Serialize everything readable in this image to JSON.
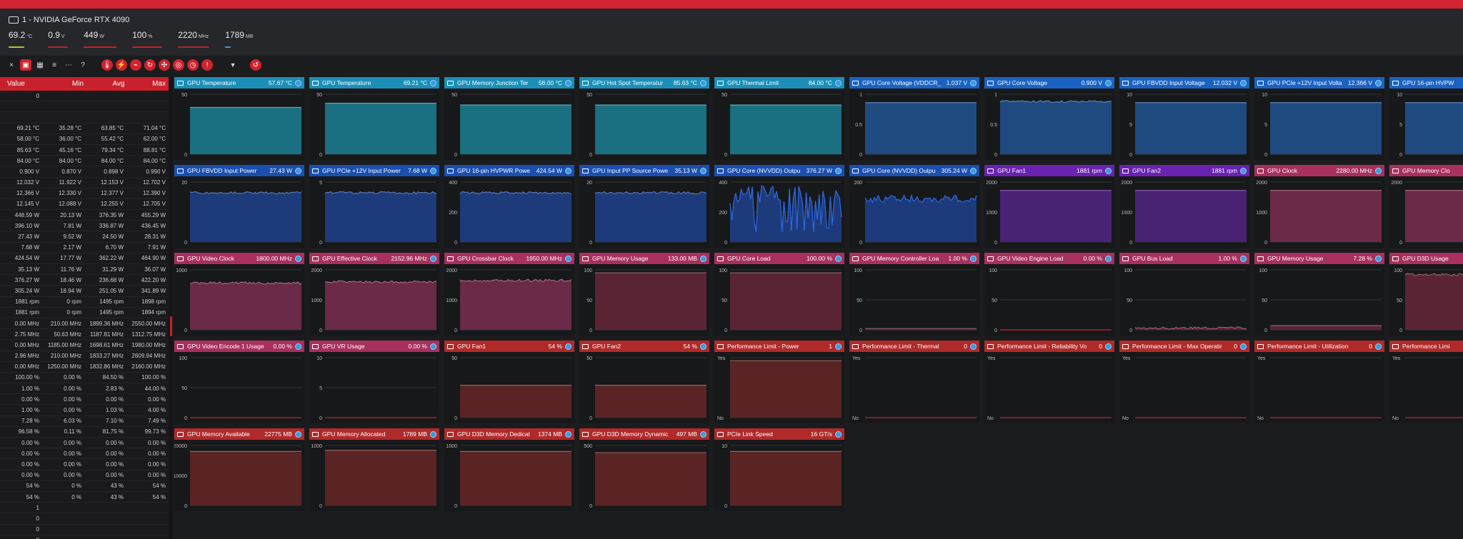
{
  "header": {
    "gpu_title": "1 - NVIDIA GeForce RTX 4090",
    "stats": [
      {
        "value": "69.2",
        "unit": "°C",
        "color": "#a0d22a",
        "level": 0.69
      },
      {
        "value": "0.9",
        "unit": "V",
        "color": "#c8202c",
        "level": 0.0
      },
      {
        "value": "449",
        "unit": "W",
        "color": "#c8202c",
        "level": 1.0
      },
      {
        "value": "100",
        "unit": "%",
        "color": "#c8202c",
        "level": 1.0
      },
      {
        "value": "2220",
        "unit": "MHz",
        "color": "#c8202c",
        "level": 0.0
      },
      {
        "value": "1789",
        "unit": "MB",
        "color": "#3a9be0",
        "level": 0.07
      }
    ]
  },
  "toolbar": {
    "icons": [
      "close-icon",
      "graph-icon",
      "layout-icon",
      "list-icon",
      "more-icon",
      "help-icon",
      "temperature-icon",
      "power-icon",
      "voltage-icon",
      "speed-icon",
      "fan-icon",
      "gauge-icon",
      "clock-icon",
      "alert-icon",
      "filter-icon",
      "reset-icon"
    ]
  },
  "table": {
    "headers": [
      "Value",
      "Min",
      "Avg",
      "Max"
    ],
    "rows": [
      [
        "0",
        "",
        "",
        ""
      ],
      [
        "",
        "",
        "",
        ""
      ],
      [
        "",
        "",
        "",
        ""
      ],
      [
        "69.21 °C",
        "35.28 °C",
        "63.85 °C",
        "71.04 °C"
      ],
      [
        "58.00 °C",
        "36.00 °C",
        "55.42 °C",
        "62.00 °C"
      ],
      [
        "85.63 °C",
        "45.16 °C",
        "79.34 °C",
        "88.81 °C"
      ],
      [
        "84.00 °C",
        "84.00 °C",
        "84.00 °C",
        "84.00 °C"
      ],
      [
        "0.900 V",
        "0.870 V",
        "0.898 V",
        "0.990 V"
      ],
      [
        "12.032 V",
        "11.922 V",
        "12.153 V",
        "12.702 V"
      ],
      [
        "12.366 V",
        "12.330 V",
        "12.377 V",
        "12.390 V"
      ],
      [
        "12.145 V",
        "12.088 V",
        "12.255 V",
        "12.705 V"
      ],
      [
        "448.59 W",
        "20.13 W",
        "376.35 W",
        "455.29 W"
      ],
      [
        "396.10 W",
        "7.81 W",
        "336.87 W",
        "436.45 W"
      ],
      [
        "27.43 W",
        "9.52 W",
        "24.50 W",
        "28.31 W"
      ],
      [
        "7.68 W",
        "2.17 W",
        "6.70 W",
        "7.91 W"
      ],
      [
        "424.54 W",
        "17.77 W",
        "362.22 W",
        "464.90 W"
      ],
      [
        "35.13 W",
        "11.76 W",
        "31.29 W",
        "36.07 W"
      ],
      [
        "376.27 W",
        "18.46 W",
        "236.68 W",
        "422.20 W"
      ],
      [
        "305.24 W",
        "18.94 W",
        "251.05 W",
        "341.89 W"
      ],
      [
        "1881 rpm",
        "0 rpm",
        "1495 rpm",
        "1898 rpm"
      ],
      [
        "1881 rpm",
        "0 rpm",
        "1495 rpm",
        "1894 rpm"
      ],
      [
        "0.00 MHz",
        "210.00 MHz",
        "1899.36 MHz",
        "2550.00 MHz"
      ],
      [
        "2.75 MHz",
        "50.63 MHz",
        "1187.81 MHz",
        "1312.75 MHz"
      ],
      [
        "0.00 MHz",
        "1185.00 MHz",
        "1698.61 MHz",
        "1980.00 MHz"
      ],
      [
        "2.96 MHz",
        "210.00 MHz",
        "1833.27 MHz",
        "2609.94 MHz"
      ],
      [
        "0.00 MHz",
        "1250.00 MHz",
        "1832.86 MHz",
        "2160.00 MHz"
      ],
      [
        "100.00 %",
        "0.00 %",
        "84.50 %",
        "100.00 %"
      ],
      [
        "1.00 %",
        "0.00 %",
        "2.83 %",
        "44.00 %"
      ],
      [
        "0.00 %",
        "0.00 %",
        "0.00 %",
        "0.00 %"
      ],
      [
        "1.00 %",
        "0.00 %",
        "1.03 %",
        "4.00 %"
      ],
      [
        "7.28 %",
        "6.03 %",
        "7.10 %",
        "7.49 %"
      ],
      [
        "96.58 %",
        "0.11 %",
        "81.75 %",
        "99.73 %"
      ],
      [
        "0.00 %",
        "0.00 %",
        "0.00 %",
        "0.00 %"
      ],
      [
        "0.00 %",
        "0.00 %",
        "0.00 %",
        "0.00 %"
      ],
      [
        "0.00 %",
        "0.00 %",
        "0.00 %",
        "0.00 %"
      ],
      [
        "0.00 %",
        "0.00 %",
        "0.00 %",
        "0.00 %"
      ],
      [
        "54 %",
        "0 %",
        "43 %",
        "54 %"
      ],
      [
        "54 %",
        "0 %",
        "43 %",
        "54 %"
      ],
      [
        "1",
        "",
        "",
        ""
      ],
      [
        "0",
        "",
        "",
        ""
      ],
      [
        "0",
        "",
        "",
        ""
      ],
      [
        "0",
        "",
        "",
        ""
      ]
    ]
  },
  "panels": [
    {
      "name": "GPU Temperature",
      "value": "57.67 °C",
      "color": "#1b8fb8",
      "chart": "#1a6f80",
      "ymax": "",
      "yticks": [
        "50",
        "0"
      ],
      "level": 0.78,
      "kind": "flat"
    },
    {
      "name": "GPU Temperature",
      "value": "69.21 °C",
      "color": "#1b8fb8",
      "chart": "#1a6f80",
      "yticks": [
        "50",
        "0"
      ],
      "level": 0.85,
      "kind": "flat"
    },
    {
      "name": "GPU Memory Junction Ter",
      "value": "58.00 °C",
      "color": "#1b8fb8",
      "chart": "#1a6f80",
      "yticks": [
        "50",
        "0"
      ],
      "level": 0.82,
      "kind": "flat"
    },
    {
      "name": "GPU Hot Spot Temperatur",
      "value": "85.63 °C",
      "color": "#1b8fb8",
      "chart": "#1a6f80",
      "yticks": [
        "50",
        "0"
      ],
      "level": 0.82,
      "kind": "flat"
    },
    {
      "name": "GPU Thermal Limit",
      "value": "84.00 °C",
      "color": "#1b8fb8",
      "chart": "#1a6f80",
      "yticks": [
        "50",
        "0"
      ],
      "level": 0.82,
      "kind": "flat"
    },
    {
      "name": "GPU Core Voltage (VDDCR_",
      "value": "1.037 V",
      "color": "#1a63c2",
      "chart": "#1f4a80",
      "yticks": [
        "1",
        "0.5",
        "0"
      ],
      "level": 0.86,
      "kind": "flat"
    },
    {
      "name": "GPU Core Voltage",
      "value": "0.900 V",
      "color": "#1a63c2",
      "chart": "#1f4a80",
      "yticks": [
        "1",
        "0.5",
        "0"
      ],
      "level": 0.88,
      "kind": "noisy"
    },
    {
      "name": "GPU FBVDD Input Voltage",
      "value": "12.032 V",
      "color": "#1a63c2",
      "chart": "#1f4a80",
      "yticks": [
        "10",
        "5",
        "0"
      ],
      "level": 0.86,
      "kind": "flat"
    },
    {
      "name": "GPU PCIe +12V Input Volta",
      "value": "12.366 V",
      "color": "#1a63c2",
      "chart": "#1f4a80",
      "yticks": [
        "10",
        "5",
        "0"
      ],
      "level": 0.86,
      "kind": "flat"
    },
    {
      "name": "GPU 16-pin HVPW",
      "value": "",
      "color": "#1a63c2",
      "chart": "#1f4a80",
      "yticks": [
        "10",
        "5",
        "0"
      ],
      "level": 0.86,
      "kind": "flat"
    },
    {
      "name": "GPU FBVDD Input Power",
      "value": "27.43 W",
      "color": "#1a4fb0",
      "chart": "#1d3b7a",
      "yticks": [
        "20",
        "0"
      ],
      "level": 0.82,
      "kind": "noisy"
    },
    {
      "name": "GPU PCIe +12V Input Power",
      "value": "7.68 W",
      "color": "#1a4fb0",
      "chart": "#1d3b7a",
      "yticks": [
        "5",
        "0"
      ],
      "level": 0.82,
      "kind": "noisy"
    },
    {
      "name": "GPU 16-pin HVPWR Powe",
      "value": "424.54 W",
      "color": "#1a4fb0",
      "chart": "#1d3b7a",
      "yticks": [
        "400",
        "200",
        "0"
      ],
      "level": 0.82,
      "kind": "noisy"
    },
    {
      "name": "GPU Input PP Source Powe",
      "value": "35.13 W",
      "color": "#1a4fb0",
      "chart": "#1d3b7a",
      "yticks": [
        "20",
        "0"
      ],
      "level": 0.82,
      "kind": "noisy"
    },
    {
      "name": "GPU Core (NVVDD) Outpu",
      "value": "376.27 W",
      "color": "#1a4fb0",
      "chart": "#1d3b7a",
      "yticks": [
        "400",
        "200",
        "0"
      ],
      "level": 0.7,
      "kind": "spiky"
    },
    {
      "name": "GPU Core (NVVDD) Outpu",
      "value": "305.24 W",
      "color": "#1a4fb0",
      "chart": "#1d3b7a",
      "yticks": [
        "200",
        "0"
      ],
      "level": 0.72,
      "kind": "noisy2"
    },
    {
      "name": "GPU Fan1",
      "value": "1881 rpm",
      "color": "#6a22b0",
      "chart": "#4a2273",
      "yticks": [
        "2000",
        "1000",
        "0"
      ],
      "level": 0.86,
      "kind": "flat"
    },
    {
      "name": "GPU Fan2",
      "value": "1881 rpm",
      "color": "#6a22b0",
      "chart": "#4a2273",
      "yticks": [
        "2000",
        "1000",
        "0"
      ],
      "level": 0.86,
      "kind": "flat"
    },
    {
      "name": "GPU Clock",
      "value": "2280.00 MHz",
      "color": "#a8305e",
      "chart": "#6a2a48",
      "yticks": [
        "2000",
        "1000",
        "0"
      ],
      "level": 0.86,
      "kind": "flat"
    },
    {
      "name": "GPU Memory Clo",
      "value": "",
      "color": "#a8305e",
      "chart": "#6a2a48",
      "yticks": [
        "2000",
        "0"
      ],
      "level": 0.86,
      "kind": "flat"
    },
    {
      "name": "GPU Video Clock",
      "value": "1800.00 MHz",
      "color": "#a8305e",
      "chart": "#6a2a48",
      "yticks": [
        "1000",
        "0"
      ],
      "level": 0.78,
      "kind": "noisy"
    },
    {
      "name": "GPU Effective Clock",
      "value": "2152.96 MHz",
      "color": "#a8305e",
      "chart": "#6a2a48",
      "yticks": [
        "2000",
        "1000",
        "0"
      ],
      "level": 0.8,
      "kind": "noisy"
    },
    {
      "name": "GPU Crossbar Clock",
      "value": "1950.00 MHz",
      "color": "#a8305e",
      "chart": "#6a2a48",
      "yticks": [
        "2000",
        "1000",
        "0"
      ],
      "level": 0.82,
      "kind": "noisy"
    },
    {
      "name": "GPU Memory Usage",
      "value": "133.00 MB",
      "color": "#a8305e",
      "chart": "#5a2434",
      "yticks": [
        "100",
        "50",
        "0"
      ],
      "level": 0.95,
      "kind": "flat"
    },
    {
      "name": "GPU Core Load",
      "value": "100.00 %",
      "color": "#a8305e",
      "chart": "#5a2434",
      "yticks": [
        "100",
        "50",
        "0"
      ],
      "level": 0.95,
      "kind": "flat"
    },
    {
      "name": "GPU Memory Controller Loa",
      "value": "1.00 %",
      "color": "#a8305e",
      "chart": "#5a2434",
      "yticks": [
        "100",
        "50",
        "0"
      ],
      "level": 0.02,
      "kind": "flat"
    },
    {
      "name": "GPU Video Engine Load",
      "value": "0.00 %",
      "color": "#a8305e",
      "chart": "#5a2434",
      "yticks": [
        "100",
        "50",
        "0"
      ],
      "level": 0.0,
      "kind": "flat"
    },
    {
      "name": "GPU Bus Load",
      "value": "1.00 %",
      "color": "#a8305e",
      "chart": "#5a2434",
      "yticks": [
        "100",
        "50",
        "0"
      ],
      "level": 0.03,
      "kind": "noisy"
    },
    {
      "name": "GPU Memory Usage",
      "value": "7.28 %",
      "color": "#a8305e",
      "chart": "#5a2434",
      "yticks": [
        "100",
        "50",
        "0"
      ],
      "level": 0.07,
      "kind": "flat"
    },
    {
      "name": "GPU D3D Usage",
      "value": "",
      "color": "#a8305e",
      "chart": "#5a2434",
      "yticks": [
        "100",
        "50",
        "0"
      ],
      "level": 0.92,
      "kind": "noisy"
    },
    {
      "name": "GPU Video Encode 1 Usage",
      "value": "0.00 %",
      "color": "#a8305e",
      "chart": "#5a2434",
      "yticks": [
        "100",
        "50",
        "0"
      ],
      "level": 0.0,
      "kind": "flat"
    },
    {
      "name": "GPU VR Usage",
      "value": "0.00 %",
      "color": "#a8305e",
      "chart": "#5a2434",
      "yticks": [
        "10",
        "5",
        "0"
      ],
      "level": 0.0,
      "kind": "flat"
    },
    {
      "name": "GPU Fan1",
      "value": "54 %",
      "color": "#b02a2a",
      "chart": "#5a2424",
      "yticks": [
        "50",
        "0"
      ],
      "level": 0.54,
      "kind": "flat"
    },
    {
      "name": "GPU Fan2",
      "value": "54 %",
      "color": "#b02a2a",
      "chart": "#5a2424",
      "yticks": [
        "50",
        "0"
      ],
      "level": 0.54,
      "kind": "flat"
    },
    {
      "name": "Performance Limit - Power",
      "value": "1",
      "color": "#b02a2a",
      "chart": "#5a2424",
      "yticks": [
        "Yes",
        "No"
      ],
      "level": 0.95,
      "kind": "flat"
    },
    {
      "name": "Performance Limit - Thermal",
      "value": "0",
      "color": "#b02a2a",
      "chart": "#5a2424",
      "yticks": [
        "Yes",
        "No"
      ],
      "level": 0.0,
      "kind": "flat"
    },
    {
      "name": "Performance Limit - Reliability Vo",
      "value": "0",
      "color": "#b02a2a",
      "chart": "#5a2424",
      "yticks": [
        "Yes",
        "No"
      ],
      "level": 0.0,
      "kind": "flat"
    },
    {
      "name": "Performance Limit - Max Operatir",
      "value": "0",
      "color": "#b02a2a",
      "chart": "#5a2424",
      "yticks": [
        "Yes",
        "No"
      ],
      "level": 0.0,
      "kind": "flat"
    },
    {
      "name": "Performance Limit - Utilization",
      "value": "0",
      "color": "#b02a2a",
      "chart": "#5a2424",
      "yticks": [
        "Yes",
        "No"
      ],
      "level": 0.0,
      "kind": "flat"
    },
    {
      "name": "Performance Limi",
      "value": "",
      "color": "#b02a2a",
      "chart": "#5a2424",
      "yticks": [
        "Yes",
        "No"
      ],
      "level": 0.0,
      "kind": "flat"
    },
    {
      "name": "GPU Memory Available",
      "value": "22775 MB",
      "color": "#b02a2a",
      "chart": "#5a2424",
      "yticks": [
        "20000",
        "10000",
        "0"
      ],
      "level": 0.9,
      "kind": "flat"
    },
    {
      "name": "GPU Memory Allocated",
      "value": "1789 MB",
      "color": "#b02a2a",
      "chart": "#5a2424",
      "yticks": [
        "1000",
        "0"
      ],
      "level": 0.92,
      "kind": "flat"
    },
    {
      "name": "GPU D3D Memory Dedicat",
      "value": "1374 MB",
      "color": "#b02a2a",
      "chart": "#5a2424",
      "yticks": [
        "1000",
        "0"
      ],
      "level": 0.9,
      "kind": "flat"
    },
    {
      "name": "GPU D3D Memory Dynamic",
      "value": "497 MB",
      "color": "#b02a2a",
      "chart": "#5a2424",
      "yticks": [
        "500",
        "0"
      ],
      "level": 0.88,
      "kind": "flat"
    },
    {
      "name": "PCIe Link Speed",
      "value": "16 GT/s",
      "color": "#b02a2a",
      "chart": "#5a2424",
      "yticks": [
        "10",
        "0"
      ],
      "level": 0.9,
      "kind": "flat"
    }
  ]
}
